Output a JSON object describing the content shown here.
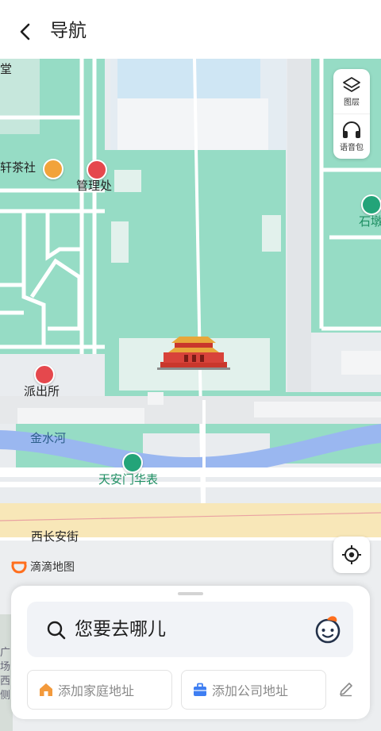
{
  "header": {
    "title": "导航",
    "back_icon": "chevron-left-icon"
  },
  "map": {
    "labels": {
      "hall_partial": "堂",
      "teahouse": "轩茶社",
      "admin_office": "管理处",
      "stone_partial": "石墩",
      "police_station": "派出所",
      "river": "金水河",
      "huabiao": "天安门华表",
      "street": "西长安街",
      "square_partial": "广场西侧"
    },
    "tools": [
      {
        "label": "图层",
        "icon": "layers-icon"
      },
      {
        "label": "语音包",
        "icon": "headphones-icon"
      }
    ],
    "locate_icon": "crosshair-icon",
    "brand": {
      "label": "滴滴地图",
      "icon": "didi-logo-icon"
    },
    "landmark_icon": "tiananmen-icon"
  },
  "sheet": {
    "search_placeholder": "您要去哪儿",
    "home_label": "添加家庭地址",
    "company_label": "添加公司地址"
  },
  "colors": {
    "park_green": "#96dcc5",
    "road_white": "#ffffff",
    "river_blue": "#9ab7f0",
    "avenue_yellow": "#f8e7b8",
    "accent_red": "#e5484d",
    "brand_orange": "#ff6f1e"
  }
}
